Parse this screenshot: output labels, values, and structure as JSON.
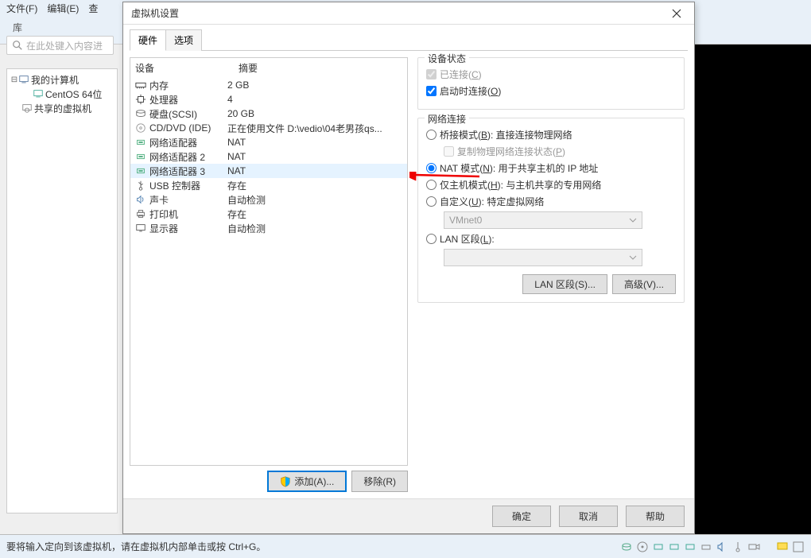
{
  "menubar": {
    "file": "文件(F)",
    "edit": "编辑(E)",
    "view_cut": "查"
  },
  "library": {
    "label": "库",
    "search_placeholder": "在此处键入内容进"
  },
  "tree": {
    "root": "我的计算机",
    "child1": "CentOS 64位",
    "shared": "共享的虚拟机"
  },
  "dialog": {
    "title": "虚拟机设置",
    "tabs": {
      "hardware": "硬件",
      "options": "选项"
    },
    "headers": {
      "device": "设备",
      "summary": "摘要"
    },
    "devices": [
      {
        "icon": "memory",
        "name": "内存",
        "summary": "2 GB"
      },
      {
        "icon": "cpu",
        "name": "处理器",
        "summary": "4"
      },
      {
        "icon": "hdd",
        "name": "硬盘(SCSI)",
        "summary": "20 GB"
      },
      {
        "icon": "cd",
        "name": "CD/DVD (IDE)",
        "summary": "正在使用文件 D:\\vedio\\04老男孩qs..."
      },
      {
        "icon": "net",
        "name": "网络适配器",
        "summary": "NAT"
      },
      {
        "icon": "net",
        "name": "网络适配器 2",
        "summary": "NAT"
      },
      {
        "icon": "net",
        "name": "网络适配器 3",
        "summary": "NAT",
        "selected": true
      },
      {
        "icon": "usb",
        "name": "USB 控制器",
        "summary": "存在"
      },
      {
        "icon": "sound",
        "name": "声卡",
        "summary": "自动检测"
      },
      {
        "icon": "printer",
        "name": "打印机",
        "summary": "存在"
      },
      {
        "icon": "display",
        "name": "显示器",
        "summary": "自动检测"
      }
    ],
    "add_btn": "添加(A)...",
    "remove_btn": "移除(R)",
    "device_status": {
      "title": "设备状态",
      "connected": "已连接(C)",
      "connect_on_poweron": "启动时连接(O)"
    },
    "net_connection": {
      "title": "网络连接",
      "bridged": "桥接模式(B): 直接连接物理网络",
      "replicate": "复制物理网络连接状态(P)",
      "nat": "NAT 模式(N): 用于共享主机的 IP 地址",
      "hostonly": "仅主机模式(H): 与主机共享的专用网络",
      "custom": "自定义(U): 特定虚拟网络",
      "custom_value": "VMnet0",
      "lan_segment": "LAN 区段(L):",
      "lan_btn": "LAN 区段(S)...",
      "advanced_btn": "高级(V)..."
    },
    "footer": {
      "ok": "确定",
      "cancel": "取消",
      "help": "帮助"
    }
  },
  "statusbar": {
    "text": "要将输入定向到该虚拟机，请在虚拟机内部单击或按 Ctrl+G。"
  }
}
